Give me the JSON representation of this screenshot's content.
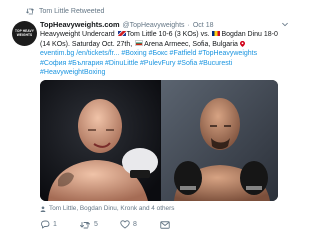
{
  "retweet": {
    "label": "Tom Little Retweeted"
  },
  "tweet": {
    "author_name": "TopHeavyweights.com",
    "handle": "@TopHeavyweights",
    "separator": "·",
    "date": "Oct 18",
    "avatar_text": "TOP HEAVY WEIGHTS",
    "text": {
      "p1": "Heavyweight Undercard ",
      "p2": "Tom Little 10-6 (3 KOs) vs. ",
      "p3": "Bogdan Dinu 18-0 (14 KOs). Saturday Oct. 27th, ",
      "p4": "Arena Armeec, Sofia, Bulgaria ",
      "link1": "eventim.bg",
      "link2": "/en/tickets/fr... ",
      "hashtags": "#Boxing #Бокс #Fatfield #TopHeavyweights #София #България #DinuLittle #PulevFury #Sofia #Bucuresti #HeavyweightBoxing"
    },
    "tagged": "Tom Little, Bogdan Dinu, Kronk and 4 others",
    "actions": {
      "reply_count": "1",
      "retweet_count": "5",
      "like_count": "8"
    }
  },
  "colors": {
    "link": "#1b95e0",
    "muted": "#657786",
    "text": "#14171a"
  },
  "icons": [
    "retweet-icon",
    "chevron-down-icon",
    "pin-icon",
    "person-icon",
    "reply-icon",
    "like-icon",
    "message-icon"
  ]
}
